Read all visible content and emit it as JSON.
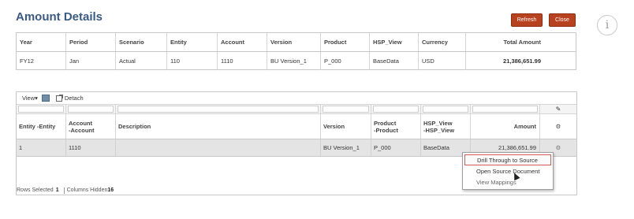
{
  "header": {
    "title": "Amount Details",
    "refresh_label": "Refresh",
    "close_label": "Close",
    "info_symbol": "i"
  },
  "summary": {
    "columns": [
      "Year",
      "Period",
      "Scenario",
      "Entity",
      "Account",
      "Version",
      "Product",
      "HSP_View",
      "Currency",
      "Total Amount"
    ],
    "values": [
      "FY12",
      "Jan",
      "Actual",
      "110",
      "1110",
      "BU Version_1",
      "P_000",
      "BaseData",
      "USD",
      "21,386,651.99"
    ]
  },
  "grid": {
    "view_label": "View",
    "detach_label": "Detach",
    "pencil_symbol": "✎",
    "columns": [
      "Entity -Entity",
      "Account\n-Account",
      "Description",
      "Version",
      "Product\n-Product",
      "HSP_View\n-HSP_View",
      "Amount",
      "⚙"
    ],
    "row": [
      "1",
      "1110",
      "",
      "BU Version_1",
      "P_000",
      "BaseData",
      "21,386,651.99",
      "⚙"
    ]
  },
  "status": {
    "rows_selected_label": "Rows Selected",
    "rows_selected_value": "1",
    "columns_hidden_label": "Columns Hidden",
    "columns_hidden_value": "16"
  },
  "context_menu": {
    "items": [
      "Drill Through to Source",
      "Open Source Document",
      "View Mappings"
    ]
  },
  "colors": {
    "title": "#3a5a85",
    "button_bg": "#b8411f",
    "menu_highlight_border": "#d65a5a"
  }
}
